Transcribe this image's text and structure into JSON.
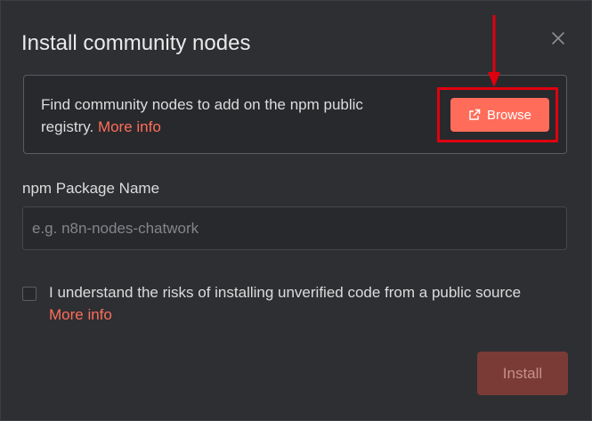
{
  "dialog": {
    "title": "Install community nodes",
    "close_icon": "close-icon"
  },
  "info": {
    "text": "Find community nodes to add on the npm public registry.",
    "more_info": "More info"
  },
  "browse": {
    "label": "Browse",
    "icon": "external-link-icon"
  },
  "package": {
    "label": "npm Package Name",
    "value": "",
    "placeholder": "e.g. n8n-nodes-chatwork"
  },
  "consent": {
    "checked": false,
    "text": "I understand the risks of installing unverified code from a public source",
    "more_info": "More info"
  },
  "install": {
    "label": "Install",
    "disabled": true
  },
  "annotation": {
    "highlight_color": "#e0000f",
    "arrow_icon": "arrow-down-icon"
  },
  "colors": {
    "accent": "#ff6d5a",
    "background": "#2e2f33"
  }
}
